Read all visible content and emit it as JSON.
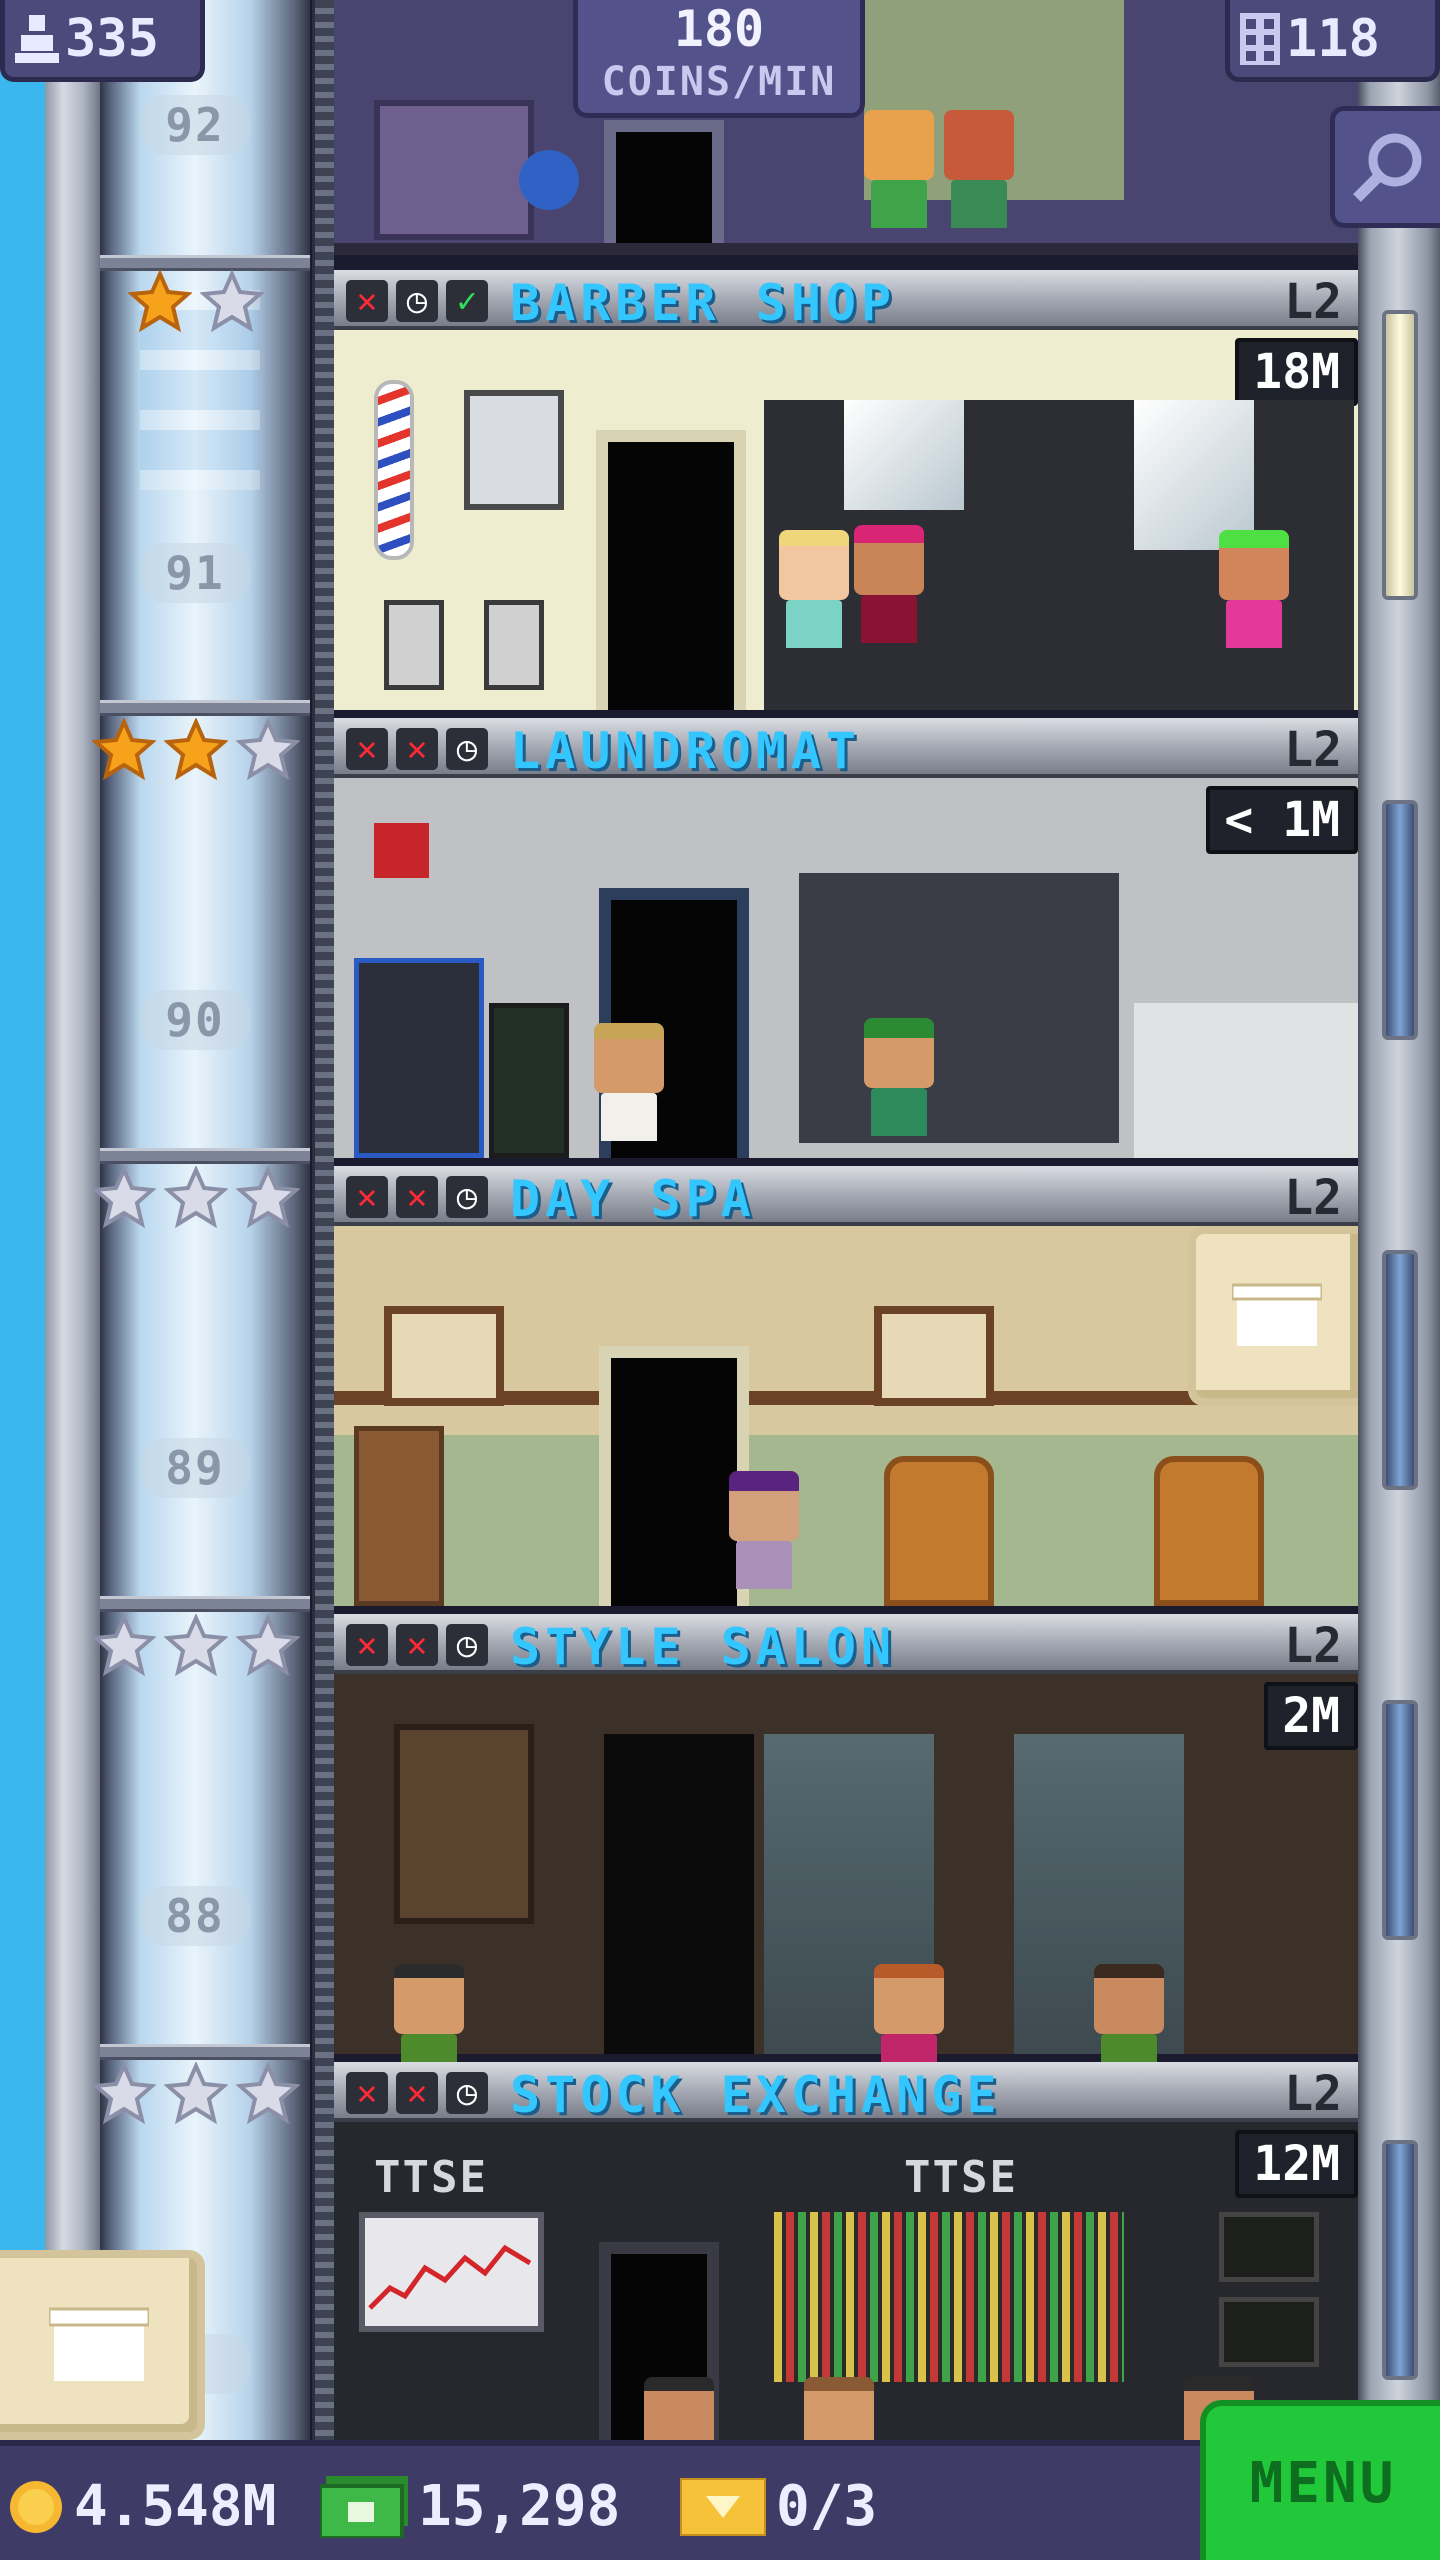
{
  "hud": {
    "population": "335",
    "coin_rate_value": "180",
    "coin_rate_unit": "COINS/MIN",
    "floor_count": "118"
  },
  "shaft": {
    "floor_labels": [
      "92",
      "91",
      "90",
      "89",
      "88",
      "7"
    ]
  },
  "floors": [
    {
      "name": "BARBER SHOP",
      "level": "L2",
      "timer": "18M",
      "stars_earned": 1,
      "stars_total": 2,
      "status_icons": [
        "cross",
        "clock",
        "check"
      ]
    },
    {
      "name": "LAUNDROMAT",
      "level": "L2",
      "timer": "< 1M",
      "stars_earned": 2,
      "stars_total": 3,
      "status_icons": [
        "cross",
        "cross",
        "clock"
      ]
    },
    {
      "name": "DAY SPA",
      "level": "L2",
      "timer": "",
      "stars_earned": 0,
      "stars_total": 3,
      "status_icons": [
        "cross",
        "cross",
        "clock"
      ]
    },
    {
      "name": "STYLE SALON",
      "level": "L2",
      "timer": "2M",
      "stars_earned": 0,
      "stars_total": 3,
      "status_icons": [
        "cross",
        "cross",
        "clock"
      ]
    },
    {
      "name": "STOCK EXCHANGE",
      "level": "L2",
      "timer": "12M",
      "stars_earned": 0,
      "stars_total": 3,
      "status_icons": [
        "cross",
        "cross",
        "clock"
      ],
      "sign_text": "TTSE"
    }
  ],
  "bottom_bar": {
    "coins": "4.548M",
    "bux": "15,298",
    "tickets": "0/3",
    "menu_label": "MENU"
  },
  "icons": {
    "population": "person-icon",
    "floors": "building-icon",
    "search": "magnifier-icon",
    "coin": "coin-icon",
    "bux": "bux-icon",
    "ticket": "ticket-icon",
    "crate": "crate-icon"
  },
  "colors": {
    "floor_name": "#33c6ff",
    "star_gold": "#f7a21b",
    "star_empty": "#d9dce8",
    "menu_green": "#20c83a",
    "hud_purple": "#54528a"
  }
}
